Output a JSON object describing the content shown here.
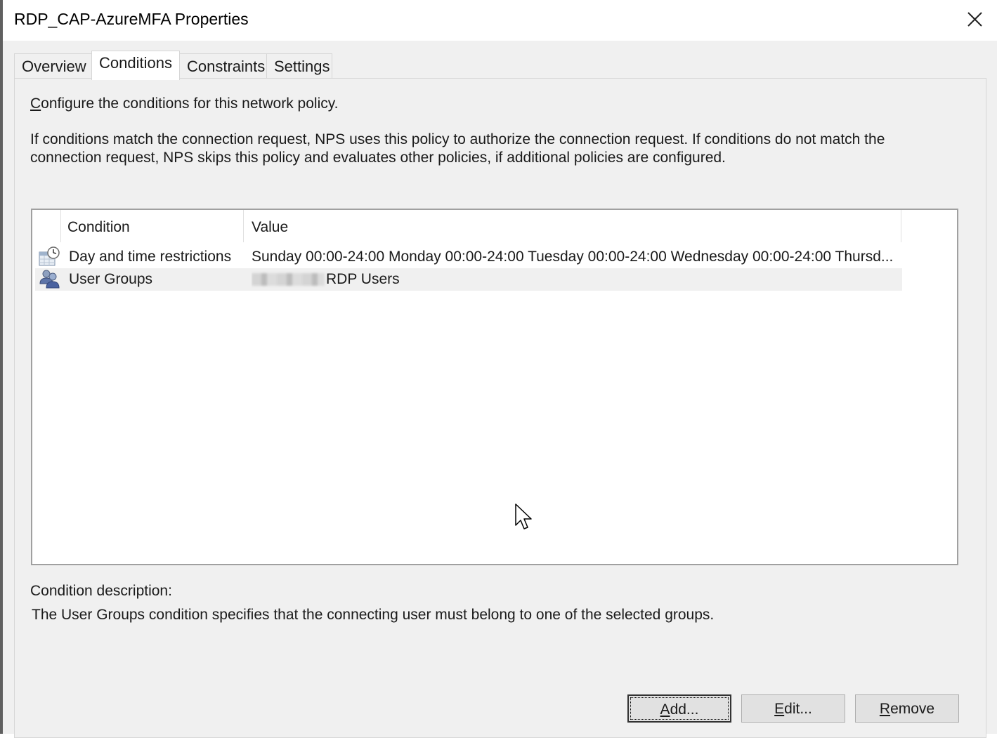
{
  "window": {
    "title": "RDP_CAP-AzureMFA Properties"
  },
  "tabs": [
    {
      "label": "Overview"
    },
    {
      "label": "Conditions"
    },
    {
      "label": "Constraints"
    },
    {
      "label": "Settings"
    }
  ],
  "active_tab": "Conditions",
  "panel": {
    "intro_hotkey": "C",
    "intro_rest": "onfigure the conditions for this network policy.",
    "explanation": "If conditions match the connection request, NPS uses this policy to authorize the connection request. If conditions do not match the connection request, NPS skips this policy and evaluates other policies, if additional policies are configured."
  },
  "conditions_table": {
    "columns": [
      "Condition",
      "Value"
    ],
    "rows": [
      {
        "icon": "calendar-clock-icon",
        "condition": "Day and time restrictions",
        "value": "Sunday 00:00-24:00 Monday 00:00-24:00 Tuesday 00:00-24:00 Wednesday 00:00-24:00 Thursd..."
      },
      {
        "icon": "user-group-icon",
        "condition": "User Groups",
        "value": "RDP Users",
        "selected": true
      }
    ]
  },
  "description": {
    "label": "Condition description:",
    "text": "The User Groups condition specifies that the connecting user must belong to one of the selected groups."
  },
  "buttons": {
    "add": {
      "hotkey": "A",
      "rest": "dd..."
    },
    "edit": {
      "hotkey": "E",
      "rest": "dit..."
    },
    "remove": {
      "hotkey": "R",
      "rest": "emove"
    }
  }
}
